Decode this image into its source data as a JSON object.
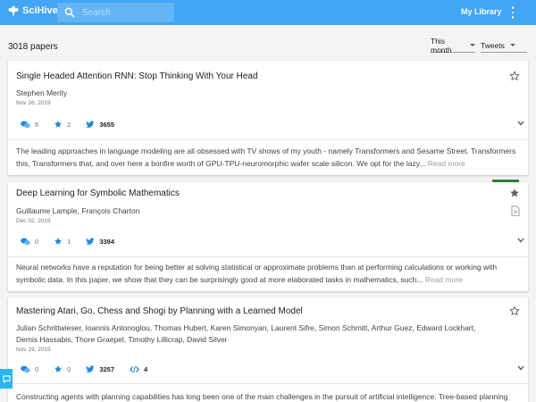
{
  "header": {
    "logo_text": "SciHive",
    "search_placeholder": "Search",
    "my_library": "My Library"
  },
  "toolbar": {
    "paper_count": "3018 papers",
    "range_selected": "This month",
    "sort_selected": "Tweets"
  },
  "colors": {
    "header_bg": "#42a5f5",
    "accent_blue": "#1e88e5",
    "green_tab": "#2e7d32"
  },
  "papers": [
    {
      "title": "Single Headed Attention RNN: Stop Thinking With Your Head",
      "authors": "Stephen Merity",
      "date": "Nov 26, 2019",
      "comments": "6",
      "stars": "2",
      "tweets": "3655",
      "abstract": "The leading approaches in language modeling are all obsessed with TV shows of my youth - namely Transformers and Sesame Street. Transformers this, Transformers that, and over here a bonfire worth of GPU-TPU-neuromorphic wafer scale silicon. We opt for the lazy...",
      "read_more": "Read more"
    },
    {
      "title": "Deep Learning for Symbolic Mathematics",
      "authors": "Guillaume Lample, François Charton",
      "date": "Dec 02, 2019",
      "comments": "0",
      "stars": "1",
      "tweets": "3394",
      "abstract": "Neural networks have a reputation for being better at solving statistical or approximate problems than at performing calculations or working with symbolic data. In this paper, we show that they can be surprisingly good at more elaborated tasks in mathematics, such...",
      "read_more": "Read more"
    },
    {
      "title": "Mastering Atari, Go, Chess and Shogi by Planning with a Learned Model",
      "authors": "Julian Schrittwieser, Ioannis Antonoglou, Thomas Hubert, Karen Simonyan, Laurent Sifre, Simon Schmitt, Arthur Guez, Edward Lockhart, Demis Hassabis, Thore Graepel, Timothy Lillicrap, David Silver",
      "date": "Nov 19, 2019",
      "comments": "0",
      "stars": "0",
      "tweets": "3257",
      "code": "4",
      "abstract": "Constructing agents with planning capabilities has long been one of the main challenges in the pursuit of artificial intelligence. Tree-based planning"
    }
  ]
}
